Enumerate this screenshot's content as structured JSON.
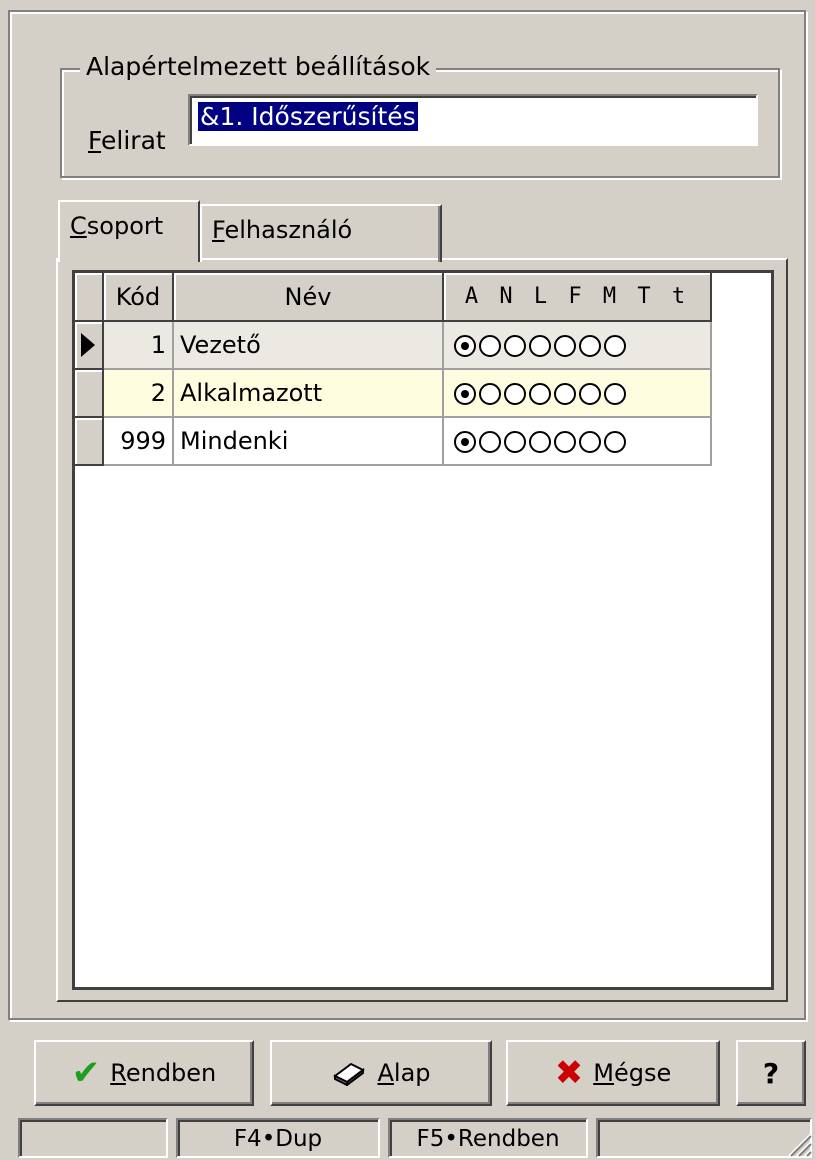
{
  "group": {
    "title": "Alapértelmezett beállítások",
    "caption_label": "Felirat",
    "caption_value": "&1. Időszerűsítés"
  },
  "tabs": [
    {
      "label": "Csoport",
      "active": true
    },
    {
      "label": "Felhasználó",
      "active": false
    }
  ],
  "grid": {
    "columns": [
      "Kód",
      "Név",
      "A N L F M T t"
    ],
    "rows": [
      {
        "code": "1",
        "name": "Vezető",
        "perm": [
          1,
          0,
          0,
          0,
          0,
          0,
          0
        ],
        "current": true
      },
      {
        "code": "2",
        "name": "Alkalmazott",
        "perm": [
          1,
          0,
          0,
          0,
          0,
          0,
          0
        ],
        "current": false
      },
      {
        "code": "999",
        "name": "Mindenki",
        "perm": [
          1,
          0,
          0,
          0,
          0,
          0,
          0
        ],
        "current": false
      }
    ]
  },
  "buttons": {
    "ok": "Rendben",
    "base": "Alap",
    "cancel": "Mégse",
    "help": "?"
  },
  "status": {
    "p1": "",
    "p2": "F4•Dup",
    "p3": "F5•Rendben",
    "p4": ""
  }
}
